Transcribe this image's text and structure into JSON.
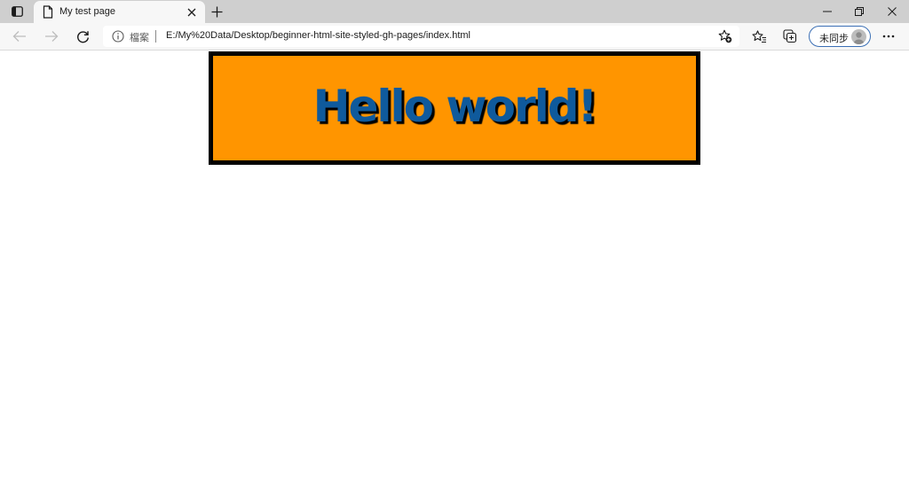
{
  "browser": {
    "tab": {
      "title": "My test page",
      "favicon": "page-icon"
    },
    "address_bar": {
      "site_label": "檔案",
      "url": "E:/My%20Data/Desktop/beginner-html-site-styled-gh-pages/index.html"
    },
    "profile": {
      "label": "未同步"
    },
    "icons": {
      "tab_actions": "tab-actions-icon",
      "close_tab": "close-icon",
      "new_tab": "plus-icon",
      "back": "back-arrow-icon",
      "forward": "forward-arrow-icon",
      "reload": "reload-icon",
      "info": "info-icon",
      "add_favorite": "star-plus-icon",
      "favorites": "favorites-icon",
      "collections": "collections-icon",
      "avatar": "avatar-icon",
      "more": "more-icon",
      "minimize": "minimize-icon",
      "maximize": "restore-icon",
      "close_window": "close-window-icon"
    }
  },
  "page": {
    "heading": "Hello world!",
    "colors": {
      "banner_background": "#ff9500",
      "banner_border": "#000000",
      "heading_text": "#0f5a9c",
      "heading_shadow": "#000000"
    }
  }
}
